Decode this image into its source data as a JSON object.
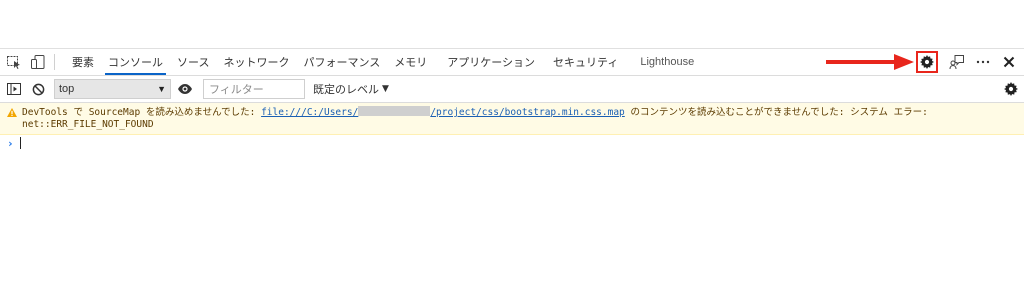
{
  "tabs": [
    {
      "label": "要素",
      "active": false
    },
    {
      "label": "コンソール",
      "active": true
    },
    {
      "label": "ソース",
      "active": false
    },
    {
      "label": "ネットワーク",
      "active": false
    },
    {
      "label": "パフォーマンス",
      "active": false
    },
    {
      "label": "メモリ",
      "active": false
    },
    {
      "label": "アプリケーション",
      "active": false
    },
    {
      "label": "セキュリティ",
      "active": false
    },
    {
      "label": "Lighthouse",
      "active": false
    }
  ],
  "toolbar": {
    "context_value": "top",
    "filter_placeholder": "フィルター",
    "levels_label": "既定のレベル"
  },
  "warning": {
    "text_prefix": "DevTools で SourceMap を読み込めませんでした: ",
    "link_start": "file:///C:/Users/",
    "link_end": "/project/css/bootstrap.min.css.map",
    "text_suffix": " のコンテンツを読み込むことができませんでした: システム エラー: net::ERR_FILE_NOT_FOUND"
  },
  "icons": {
    "inspect": "inspect-element-icon",
    "device": "device-toolbar-icon",
    "settings": "gear-icon",
    "feedback": "feedback-icon",
    "more": "more-icon",
    "close": "close-icon"
  },
  "colors": {
    "highlight": "#e8261c",
    "active_tab": "#0a64c8",
    "warning_bg": "#fffbe5",
    "link": "#1a5fb4"
  }
}
